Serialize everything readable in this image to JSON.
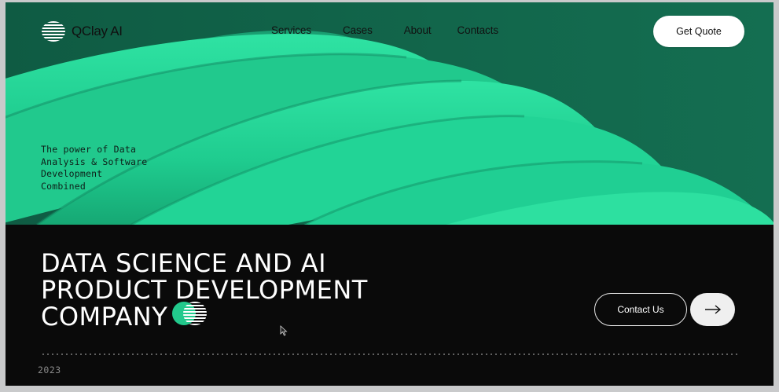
{
  "brand": {
    "name": "QClay AI"
  },
  "nav": {
    "items": [
      "Services",
      "Cases",
      "About",
      "Contacts"
    ]
  },
  "header": {
    "cta_label": "Get Quote"
  },
  "hero": {
    "tagline_lines": [
      "The power of Data",
      "Analysis & Software",
      "Development",
      "Combined"
    ]
  },
  "main": {
    "headline_lines": [
      "DATA SCIENCE AND AI",
      "PRODUCT DEVELOPMENT",
      "COMPANY"
    ],
    "contact_label": "Contact Us",
    "arrow_icon": "arrow-right-icon",
    "year": "2023"
  },
  "colors": {
    "hero_bg": "#12664b",
    "ribbon": "#22d496",
    "dark_bg": "#0a0a0a",
    "text_light": "#ffffff"
  }
}
